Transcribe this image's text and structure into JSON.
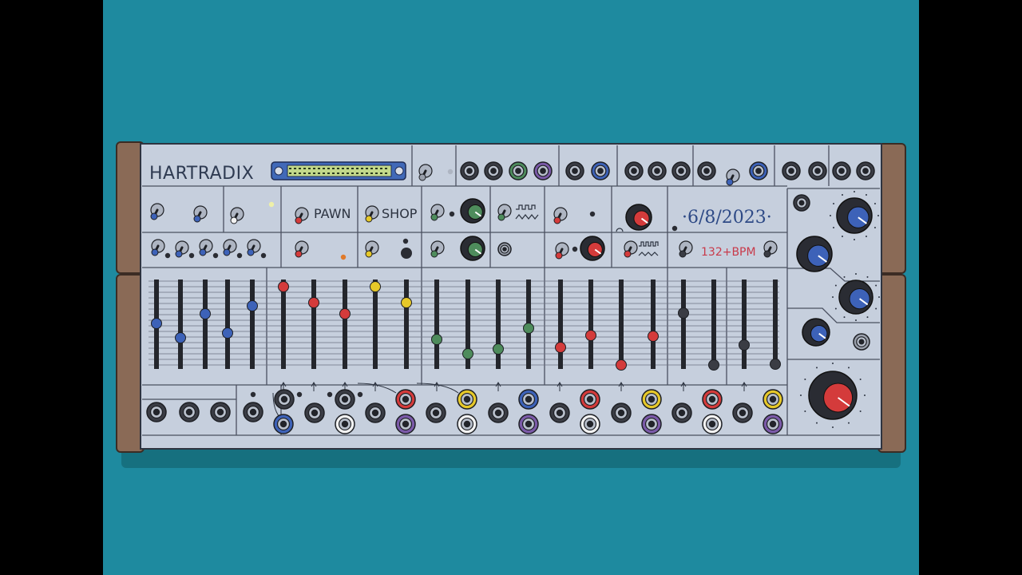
{
  "panel": {
    "brand": "HARTRADIX",
    "pawn_label": "PAWN",
    "shop_label": "SHOP",
    "date": "·6/8/2023·",
    "tempo": "132+BPM"
  },
  "colors": {
    "background": "#1e8a9f",
    "panel": "#c6cfdd",
    "wood": "#8a6a56",
    "accent_blue": "#3d62b8",
    "accent_red": "#d43b3b",
    "accent_green": "#4e8c5c",
    "accent_yellow": "#e6c829",
    "accent_purple": "#7b5aa8"
  },
  "icons": {
    "waveform_square": "square-wave-icon",
    "waveform_triangle": "triangle-wave-icon"
  }
}
